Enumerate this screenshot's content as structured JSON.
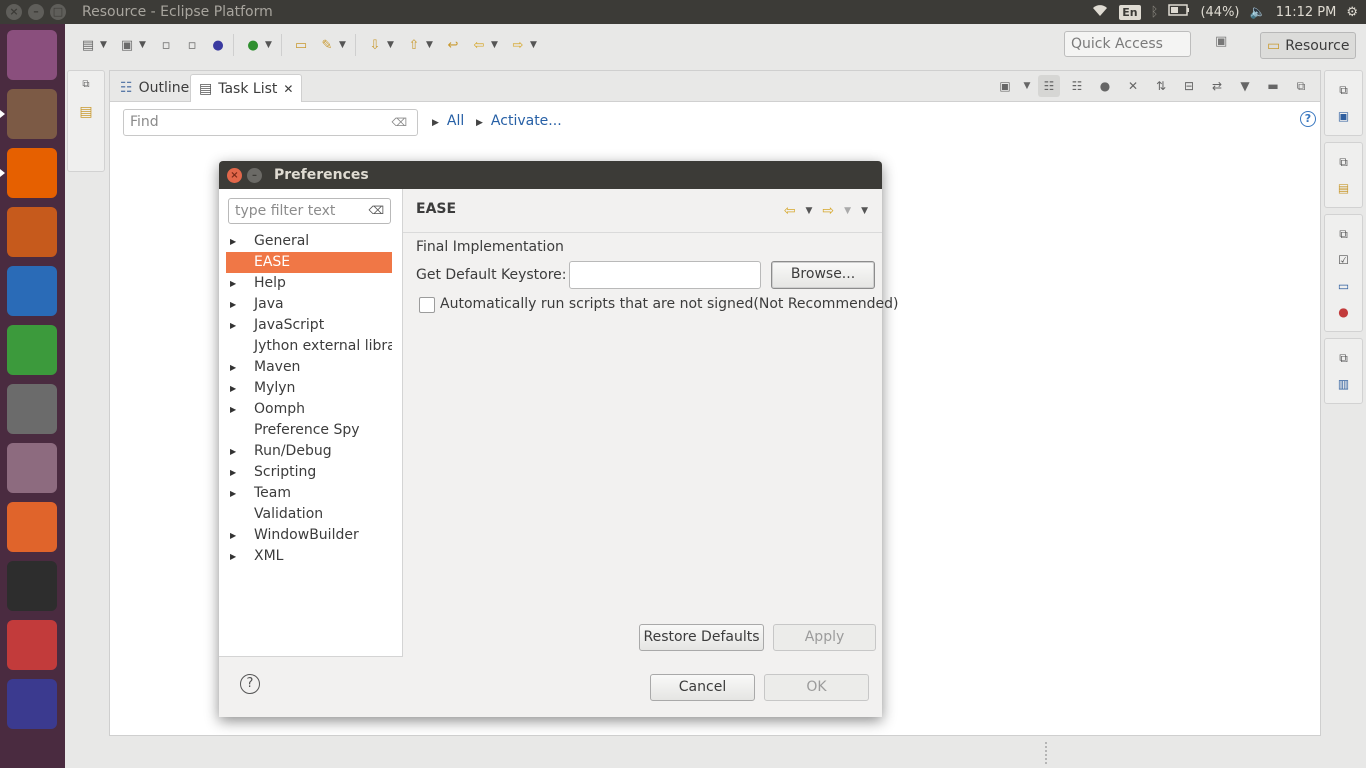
{
  "window_title": "Resource - Eclipse Platform",
  "tray": {
    "language": "En",
    "battery": "(44%)",
    "time": "11:12 PM"
  },
  "toolbar": {
    "quick_access": "Quick Access",
    "perspective": "Resource"
  },
  "views": {
    "tabs": [
      {
        "label": "Outline"
      },
      {
        "label": "Task List"
      }
    ],
    "find_placeholder": "Find",
    "filter_all": "All",
    "activate": "Activate...",
    "help_glyph": "?"
  },
  "launcher": {
    "items": [
      {
        "name": "ubuntu-dash",
        "color": "#8a4f7d"
      },
      {
        "name": "files",
        "color": "#7c5a45"
      },
      {
        "name": "firefox",
        "color": "#e66000"
      },
      {
        "name": "impress",
        "color": "#c65a1c"
      },
      {
        "name": "writer",
        "color": "#2a6bb7"
      },
      {
        "name": "calc",
        "color": "#3c9a3c"
      },
      {
        "name": "amazon",
        "color": "#6b6b6b"
      },
      {
        "name": "system-settings",
        "color": "#8d6b7f"
      },
      {
        "name": "software-center",
        "color": "#e0642b"
      },
      {
        "name": "terminal",
        "color": "#2d2d2d"
      },
      {
        "name": "pdf-viewer",
        "color": "#c23b3b"
      },
      {
        "name": "eclipse",
        "color": "#3b3a8f"
      }
    ]
  },
  "dialog": {
    "title": "Preferences",
    "filter_placeholder": "type filter text",
    "tree": [
      {
        "label": "General",
        "expandable": true
      },
      {
        "label": "EASE",
        "expandable": false,
        "selected": true
      },
      {
        "label": "Help",
        "expandable": true
      },
      {
        "label": "Java",
        "expandable": true
      },
      {
        "label": "JavaScript",
        "expandable": true
      },
      {
        "label": "Jython external libra",
        "expandable": false
      },
      {
        "label": "Maven",
        "expandable": true
      },
      {
        "label": "Mylyn",
        "expandable": true
      },
      {
        "label": "Oomph",
        "expandable": true
      },
      {
        "label": "Preference Spy",
        "expandable": false
      },
      {
        "label": "Run/Debug",
        "expandable": true
      },
      {
        "label": "Scripting",
        "expandable": true
      },
      {
        "label": "Team",
        "expandable": true
      },
      {
        "label": "Validation",
        "expandable": false
      },
      {
        "label": "WindowBuilder",
        "expandable": true
      },
      {
        "label": "XML",
        "expandable": true
      }
    ],
    "page": {
      "title": "EASE",
      "section_label": "Final Implementation",
      "keystore_label": "Get Default Keystore:",
      "keystore_value": "",
      "browse": "Browse...",
      "checkbox_label": "Automatically run scripts that are not signed(Not Recommended)",
      "checkbox_checked": false,
      "restore_defaults": "Restore Defaults",
      "apply": "Apply"
    },
    "cancel": "Cancel",
    "ok": "OK"
  }
}
